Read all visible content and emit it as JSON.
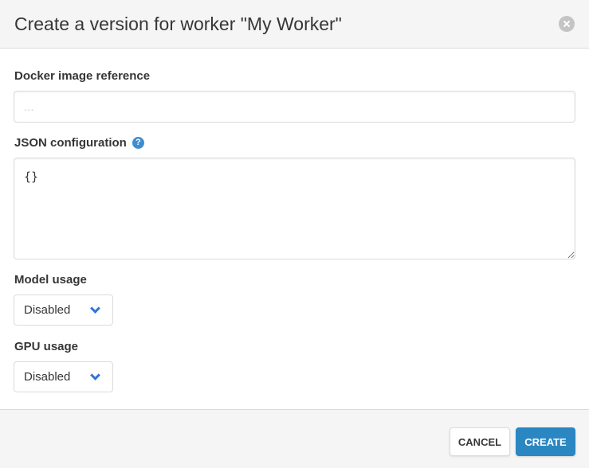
{
  "modal": {
    "title": "Create a version for worker \"My Worker\""
  },
  "form": {
    "docker": {
      "label": "Docker image reference",
      "value": "",
      "placeholder": "..."
    },
    "json_config": {
      "label": "JSON configuration",
      "help_glyph": "?",
      "value": "{}"
    },
    "model_usage": {
      "label": "Model usage",
      "selected": "Disabled"
    },
    "gpu_usage": {
      "label": "GPU usage",
      "selected": "Disabled"
    }
  },
  "footer": {
    "cancel_label": "CANCEL",
    "create_label": "CREATE"
  },
  "colors": {
    "primary": "#2a87c2",
    "chevron": "#3273dc",
    "help": "#3e8ed0"
  }
}
